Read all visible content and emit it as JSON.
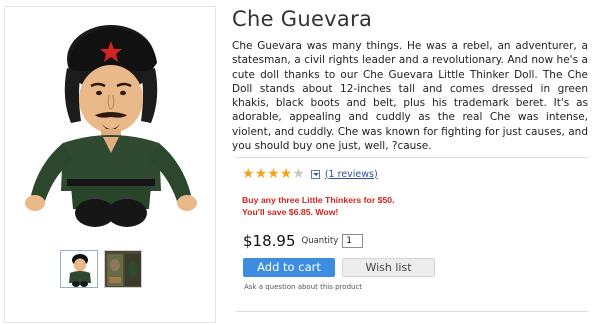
{
  "product": {
    "title": "Che Guevara",
    "description": "Che Guevara was many things. He was a rebel, an adventurer, a statesman, a civil rights leader and a revolutionary. And now he's a cute doll thanks to our Che Guevara Little Thinker Doll. The Che Doll stands about 12-inches tall and comes dressed in green khakis, black boots and belt, plus his trademark beret. It's as adorable, appealing and cuddly as the real Che was intense, violent, and cuddly. Che was known for fighting for just causes, and you should buy one just, well, ?cause."
  },
  "rating": {
    "stars_filled": 4,
    "stars_total": 5,
    "reviews_link": "(1 reviews)"
  },
  "promo": {
    "line1": "Buy any three Little Thinkers for $50.",
    "line2": "You'll save $6.85. Wow!"
  },
  "purchase": {
    "price": "$18.95",
    "quantity_label": "Quantity",
    "quantity_value": "1",
    "add_to_cart": "Add to cart",
    "wish_list": "Wish list",
    "ask_question": "Ask a question about this product"
  },
  "colors": {
    "star": "#f4a31e",
    "promo": "#d4231c",
    "cart_button": "#3d8ee0",
    "link": "#2a4fa8"
  }
}
